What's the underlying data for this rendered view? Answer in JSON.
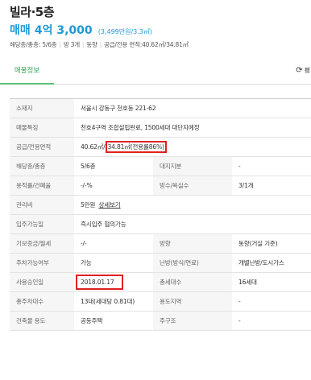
{
  "header": {
    "title": "빌라·5층",
    "price_type": "매매",
    "price_value": "4억 3,000",
    "price_per": "(3,499만원/3.3㎡)",
    "summary": {
      "floor": "해당층/총층: 5/6층",
      "rooms": "방 3개",
      "direction": "동향",
      "area": "공급/전용 면적:40.62㎡/34.81㎡"
    }
  },
  "tabs": {
    "active": "매물정보",
    "refresh_label": "평"
  },
  "table": {
    "address_label": "소재지",
    "address": "서울시 강동구 천호동 221-62",
    "feature_label": "매물특징",
    "feature": "천호4구역 조합설립완료, 1500세대 대단지예정",
    "area_label": "공급/전용면적",
    "area_supply": "40.62㎡/",
    "area_exclusive": "34.81㎡(전용률86%)",
    "floor_label": "해당층/총층",
    "floor": "5/6층",
    "land_label": "대지지분",
    "land": "-",
    "ratio_label": "용적률/건폐율",
    "ratio": "-/-%",
    "rooms_label": "방수/욕실수",
    "rooms": "3/1개",
    "fee_label": "관리비",
    "fee": "5만원",
    "fee_link": "상세보기",
    "movein_label": "입주가능일",
    "movein": "즉시입주 협의가능",
    "deposit_label": "기보증금/월세",
    "deposit": "-/-",
    "direction_label": "방향",
    "direction": "동향(거실 기준)",
    "parking_label": "주차가능여부",
    "parking": "가능",
    "heating_label": "난방(방식/연료)",
    "heating": "개별난방/도시가스",
    "approval_label": "사용승인일",
    "approval": "2018.01.17",
    "households_label": "총세대수",
    "households": "16세대",
    "total_parking_label": "총주차대수",
    "total_parking": "13대(세대당 0.81대)",
    "zoning_label": "용도지역",
    "zoning": "-",
    "usage_label": "건축물 용도",
    "usage": "공동주택",
    "structure_label": "주구조",
    "structure": "-"
  },
  "colors": {
    "accent_blue": "#1e9ad6",
    "tab_green": "#3aa55a",
    "highlight_red": "#e02020"
  }
}
